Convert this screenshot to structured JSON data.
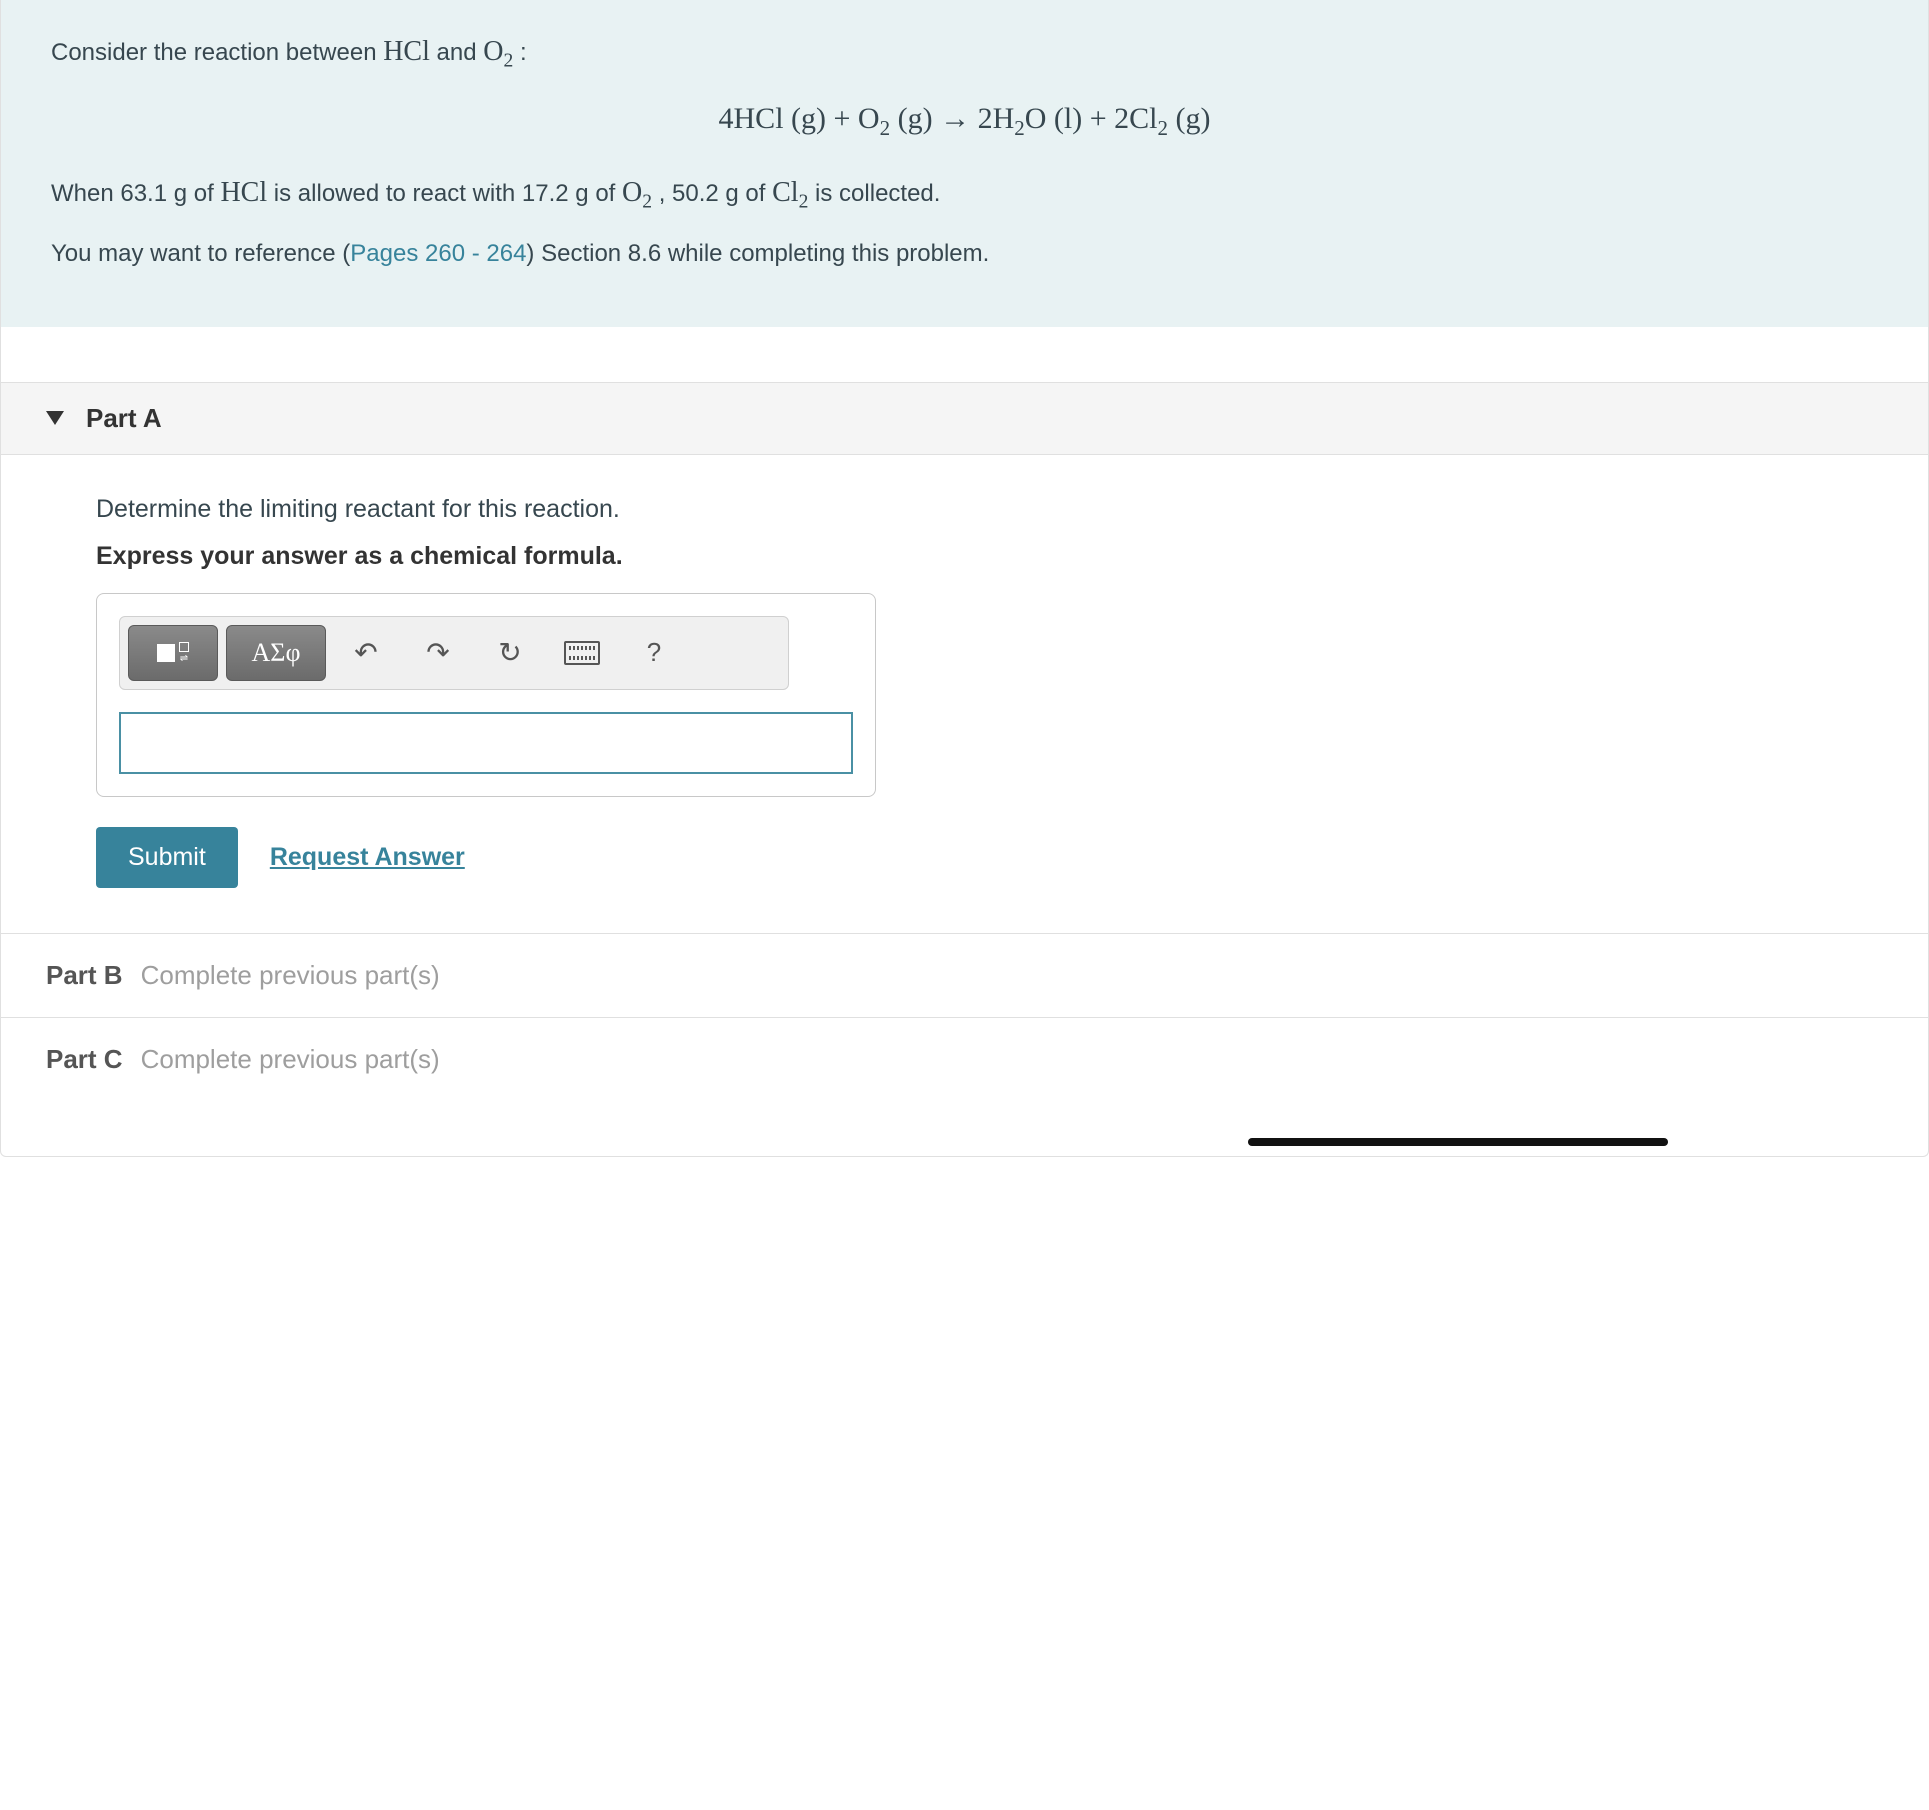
{
  "intro": {
    "line1_pre": "Consider the reaction between ",
    "hcl": "HCl",
    "line1_mid": " and ",
    "o2_pre": "O",
    "o2_sub": "2",
    "line1_post": " :",
    "equation": {
      "c1": "4HCl (g) + O",
      "s1": "2",
      "c2": " (g)  →  2H",
      "s2": "2",
      "c3": "O (l) + 2Cl",
      "s3": "2",
      "c4": " (g)"
    },
    "line2_a": "When 63.1 g of ",
    "line2_b": " is allowed to react with 17.2 g of ",
    "line2_c": " , 50.2 g of ",
    "cl2_pre": "Cl",
    "cl2_sub": "2",
    "line2_d": "  is collected.",
    "line3_a": "You may want to reference (",
    "pages_link": "Pages 260 - 264",
    "line3_b": ") Section 8.6 while completing this problem."
  },
  "partA": {
    "title": "Part A",
    "question": "Determine the limiting reactant for this reaction.",
    "instruction": "Express your answer as a chemical formula.",
    "toolbar": {
      "greek": "ΑΣφ",
      "help": "?"
    },
    "answer_value": "",
    "submit_label": "Submit",
    "request_label": "Request Answer"
  },
  "partB": {
    "label": "Part B",
    "msg": "Complete previous part(s)"
  },
  "partC": {
    "label": "Part C",
    "msg": "Complete previous part(s)"
  }
}
